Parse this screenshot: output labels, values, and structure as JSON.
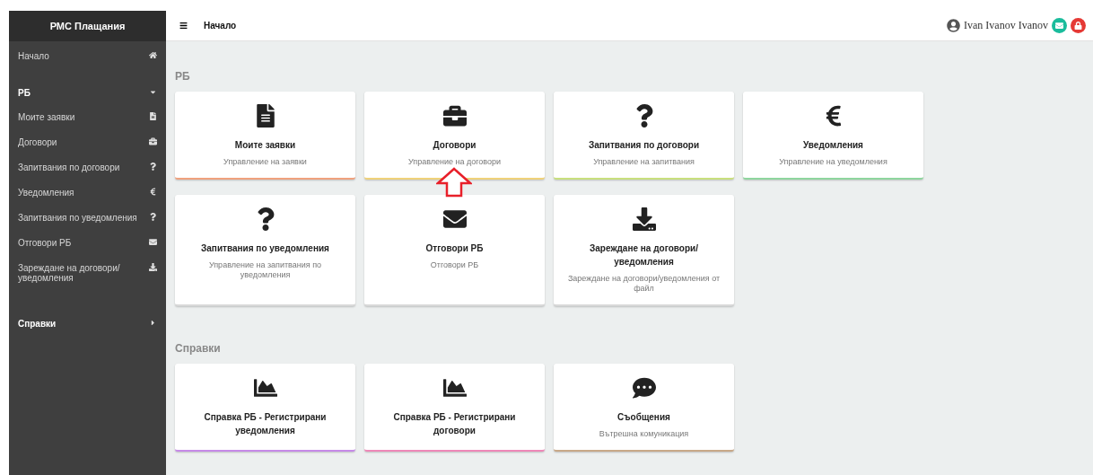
{
  "sidebar": {
    "title": "РМС Плащания",
    "items": [
      {
        "kind": "home",
        "label": "Начало"
      },
      {
        "kind": "group",
        "label": "РБ",
        "expanded": true,
        "children": [
          {
            "label": "Моите заявки",
            "kind": "document"
          },
          {
            "label": "Договори",
            "kind": "briefcase"
          },
          {
            "label": "Запитвания по договори",
            "kind": "question"
          },
          {
            "label": "Уведомления",
            "kind": "euro"
          },
          {
            "label": "Запитвания по уведомления",
            "kind": "question"
          },
          {
            "label": "Отговори РБ",
            "kind": "envelope"
          },
          {
            "label": "Зареждане на договори/уведомления",
            "kind": "download"
          }
        ]
      },
      {
        "kind": "group",
        "label": "Справки",
        "expanded": false
      }
    ]
  },
  "header": {
    "title": "Начало",
    "user": "Ivan Ivanov Ivanov"
  },
  "sections": [
    {
      "title": "РБ",
      "cards": [
        {
          "kind": "document",
          "title": "Моите заявки",
          "subtitle": "Управление на заявки",
          "color": "#f0a27e",
          "highlighted": false
        },
        {
          "kind": "briefcase",
          "title": "Договори",
          "subtitle": "Управление на договори",
          "color": "#f0d27a",
          "highlighted": true
        },
        {
          "kind": "question",
          "title": "Запитвания по договори",
          "subtitle": "Управление на запитвания",
          "color": "#c9e07e",
          "highlighted": false
        },
        {
          "kind": "euro",
          "title": "Уведомления",
          "subtitle": "Управление на уведомления",
          "color": "#8fd69e",
          "highlighted": false
        },
        {
          "kind": "question",
          "title": "Запитвания по уведомления",
          "subtitle": "Управление на запитвания по уведомления",
          "highlighted": false
        },
        {
          "kind": "envelope",
          "title": "Отговори РБ",
          "subtitle": "Отговори РБ",
          "highlighted": false
        },
        {
          "kind": "download",
          "title": "Зареждане на договори/уведомления",
          "subtitle": "Зареждане на договори/уведомления от файл",
          "highlighted": false
        }
      ]
    },
    {
      "title": "Справки",
      "cards": [
        {
          "kind": "chart",
          "title": "Справка РБ - Регистрирани уведомления",
          "color": "#c68ae8",
          "highlighted": false
        },
        {
          "kind": "chart",
          "title": "Справка РБ - Регистрирани договори",
          "color": "#ee88b8",
          "highlighted": false
        },
        {
          "kind": "chat",
          "title": "Съобщения",
          "subtitle": "Вътрешна комуникация",
          "color": "#c8a888",
          "highlighted": false
        }
      ]
    }
  ]
}
